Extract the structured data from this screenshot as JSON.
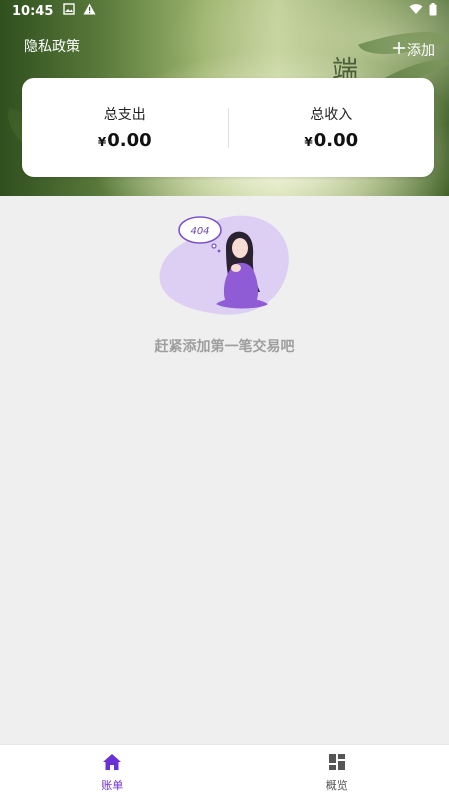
{
  "status_bar": {
    "time": "10:45"
  },
  "header": {
    "privacy_label": "隐私政策",
    "add_label": "添加",
    "calligraphy_glyph": "端"
  },
  "summary": {
    "expense_label": "总支出",
    "expense_currency": "¥",
    "expense_value": "0.00",
    "income_label": "总收入",
    "income_currency": "¥",
    "income_value": "0.00"
  },
  "empty_state": {
    "badge_text": "404",
    "message": "赶紧添加第一笔交易吧"
  },
  "bottom_nav": {
    "items": [
      {
        "label": "账单",
        "icon": "home-icon",
        "active": true
      },
      {
        "label": "概览",
        "icon": "dashboard-icon",
        "active": false
      }
    ]
  },
  "colors": {
    "accent": "#6a2fd6",
    "background": "#efefef",
    "illustration_purple": "#9a6fd8"
  }
}
